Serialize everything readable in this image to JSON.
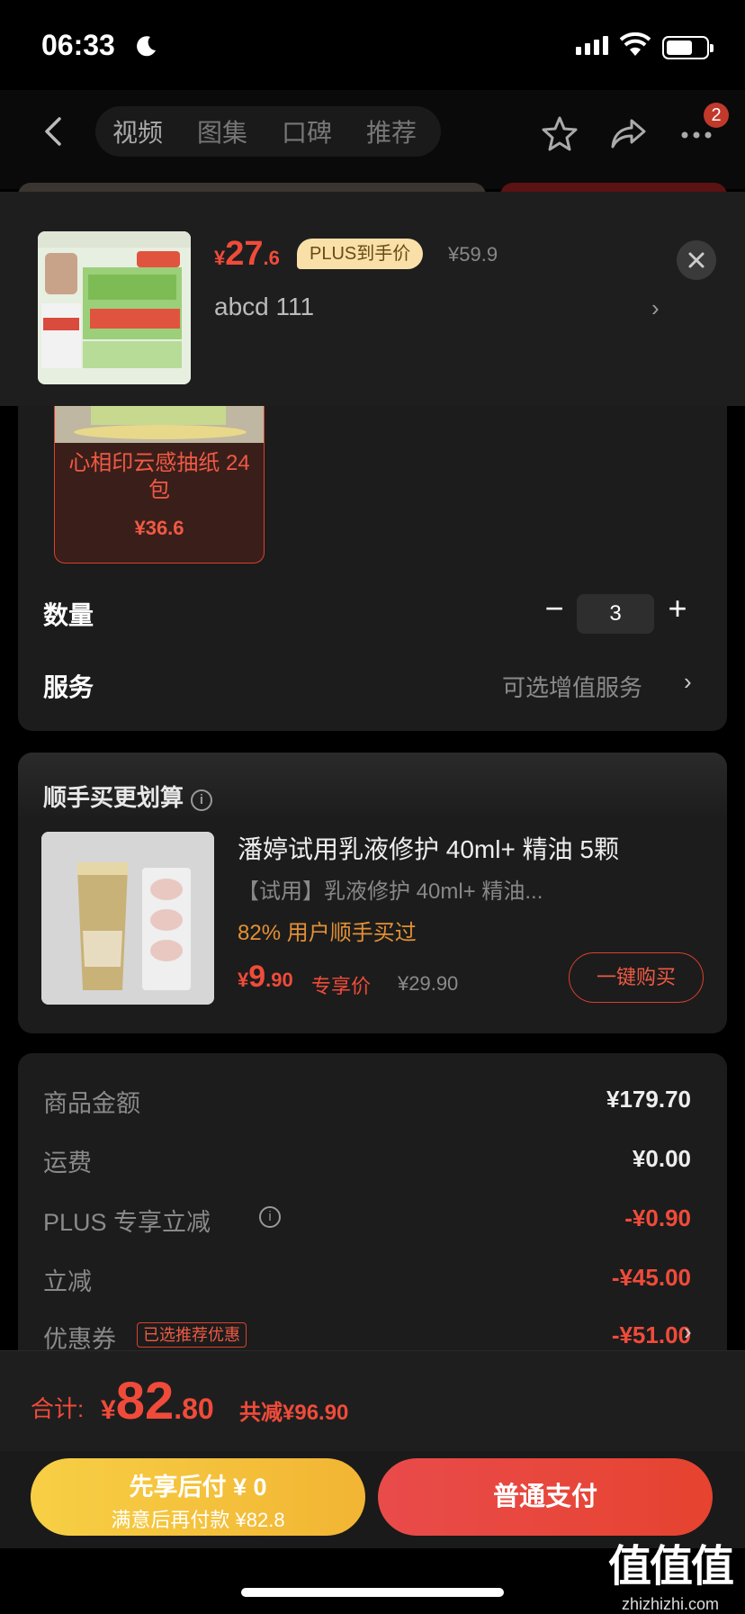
{
  "status_bar": {
    "time": "06:33"
  },
  "header": {
    "tabs": [
      {
        "label": "视频"
      },
      {
        "label": "图集"
      },
      {
        "label": "口碑"
      },
      {
        "label": "推荐"
      }
    ],
    "more_badge": "2"
  },
  "product": {
    "price_symbol": "¥",
    "price_int": "27",
    "price_dec": ".6",
    "plus_tag": "PLUS到手价",
    "original_price": "¥59.9",
    "spec": "abcd  111"
  },
  "variant": {
    "name": "心相印云感抽纸 24包",
    "price": "¥36.6"
  },
  "quantity": {
    "label": "数量",
    "value": "3"
  },
  "service": {
    "label": "服务",
    "value": "可选增值服务"
  },
  "bundle": {
    "title": "顺手买更划算",
    "name": "潘婷试用乳液修护 40ml+ 精油 5颗",
    "subtitle": "【试用】乳液修护 40ml+ 精油...",
    "stat": "82% 用户顺手买过",
    "price_symbol": "¥",
    "price_int": "9",
    "price_dec": ".90",
    "price_label": "专享价",
    "original_price": "¥29.90",
    "buy_label": "一键购买"
  },
  "summary": {
    "rows": [
      {
        "label": "商品金额",
        "value": "¥179.70"
      },
      {
        "label": "运费",
        "value": "¥0.00"
      },
      {
        "label": "PLUS 专享立减",
        "value": "-¥0.90"
      },
      {
        "label": "立减",
        "value": "-¥45.00"
      },
      {
        "label": "优惠券",
        "value": "-¥51.00",
        "tag": "已选推荐优惠"
      }
    ]
  },
  "total": {
    "label": "合计:",
    "symbol": "¥",
    "int": "82",
    "dec": ".80",
    "discount": "共减¥96.90"
  },
  "actions": {
    "later_line1": "先享后付 ¥ 0",
    "later_line2": "满意后再付款 ¥82.8",
    "pay_label": "普通支付"
  },
  "watermark": {
    "logo": "值值值",
    "site": "zhizhizhi.com"
  },
  "colors": {
    "accent_red": "#f04b3a",
    "plus_gold": "#f8e0a8",
    "later_yellow": "#f7cf45"
  }
}
